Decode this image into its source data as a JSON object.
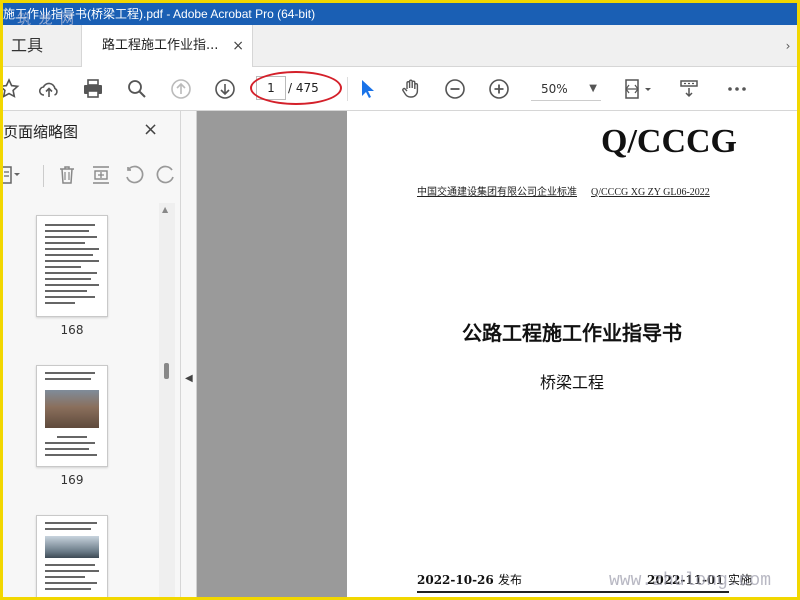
{
  "window": {
    "title": "施工作业指导书(桥梁工程).pdf - Adobe Acrobat Pro (64-bit)"
  },
  "tabs": {
    "tools_label": "工具",
    "doc_label": "路工程施工作业指...",
    "close_glyph": "×"
  },
  "toolbar": {
    "current_page": "1",
    "total_pages": "/ 475",
    "zoom": "50%",
    "accent": "#1a73e8",
    "highlight": "#d4202a"
  },
  "sidebar": {
    "title": "页面缩略图",
    "close_glyph": "×",
    "thumbnails": [
      {
        "label": "168"
      },
      {
        "label": "169"
      }
    ]
  },
  "page": {
    "std_code": "Q/CCCG",
    "org_line": "中国交通建设集团有限公司企业标准",
    "std_number": "Q/CCCG XG ZY GL06-2022",
    "title": "公路工程施工作业指导书",
    "subtitle": "桥梁工程",
    "publish_date": "2022-10-26",
    "publish_suffix": "发布",
    "effect_date": "2022-11-01",
    "effect_suffix": "实施"
  },
  "watermarks": {
    "top": "筑 龙 网",
    "bottom": "www.zhulong.com"
  }
}
